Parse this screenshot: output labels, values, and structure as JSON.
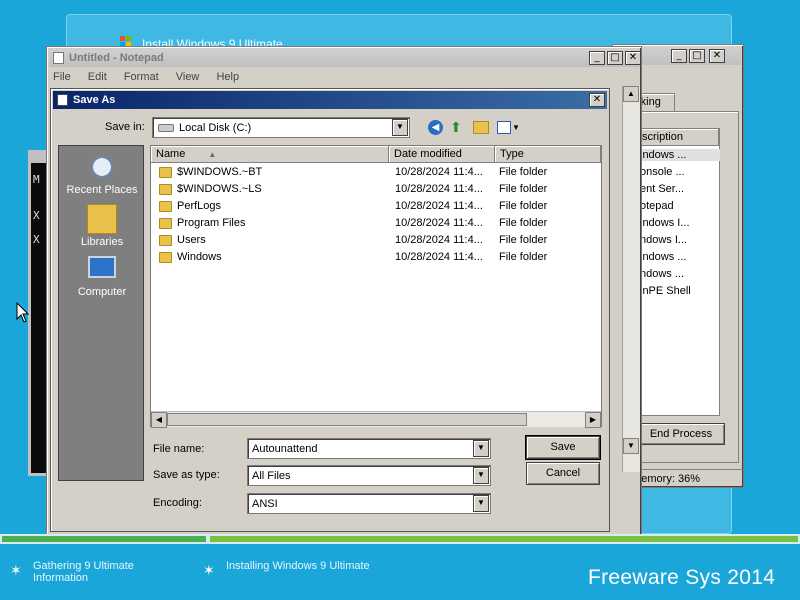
{
  "setup": {
    "title": "Install Windows 9 Ultimate",
    "steps": [
      "Gathering 9 Ultimate\nInformation",
      "Installing Windows 9 Ultimate"
    ],
    "brand": "Freeware Sys 2014"
  },
  "console": {
    "lines": [
      "M",
      "X",
      "X"
    ]
  },
  "taskmgr": {
    "tab": "rking",
    "column": "scription",
    "rows": [
      "indows ...",
      "onsole ...",
      "ent Ser...",
      "otepad",
      "indows I...",
      "ndows I...",
      "indows ...",
      "ndows ...",
      "inPE Shell"
    ],
    "end_process": "End Process",
    "memory": "cal Memory: 36%"
  },
  "notepad": {
    "title": "Untitled - Notepad",
    "menu": [
      "File",
      "Edit",
      "Format",
      "View",
      "Help"
    ]
  },
  "saveas": {
    "title": "Save As",
    "save_in_label": "Save in:",
    "save_in_value": "Local Disk (C:)",
    "places": [
      "Recent Places",
      "Libraries",
      "Computer"
    ],
    "columns": {
      "name": "Name",
      "date": "Date modified",
      "type": "Type"
    },
    "files": [
      {
        "name": "$WINDOWS.~BT",
        "date": "10/28/2024 11:4...",
        "type": "File folder"
      },
      {
        "name": "$WINDOWS.~LS",
        "date": "10/28/2024 11:4...",
        "type": "File folder"
      },
      {
        "name": "PerfLogs",
        "date": "10/28/2024 11:4...",
        "type": "File folder"
      },
      {
        "name": "Program Files",
        "date": "10/28/2024 11:4...",
        "type": "File folder"
      },
      {
        "name": "Users",
        "date": "10/28/2024 11:4...",
        "type": "File folder"
      },
      {
        "name": "Windows",
        "date": "10/28/2024 11:4...",
        "type": "File folder"
      }
    ],
    "filename_label": "File name:",
    "filename_value": "Autounattend",
    "type_label": "Save as type:",
    "type_value": "All Files",
    "encoding_label": "Encoding:",
    "encoding_value": "ANSI",
    "save_button": "Save",
    "cancel_button": "Cancel"
  },
  "colors": {
    "desktop": "#1aa6d9",
    "active_title": "#0a246a",
    "dialog_face": "#d4d0c8"
  }
}
